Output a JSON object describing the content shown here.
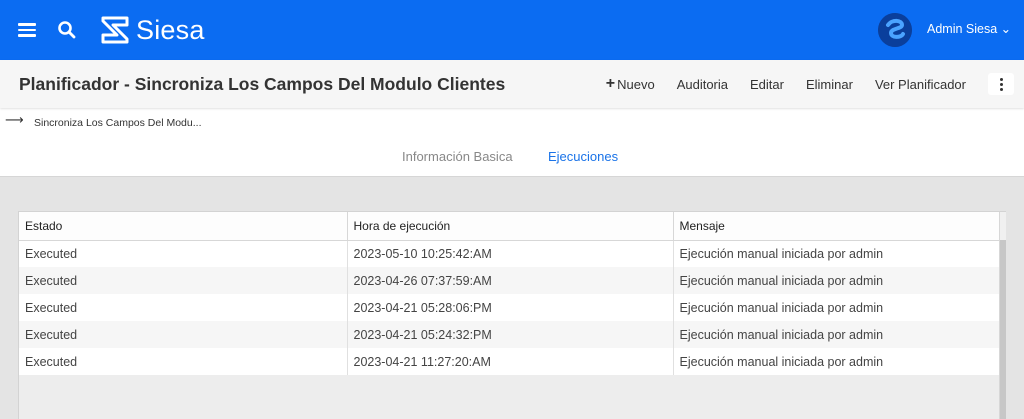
{
  "app": {
    "logo_text": "Siesa",
    "user_name": "Admin Siesa",
    "user_caret": "⌄",
    "brand_color": "#0b6cf2"
  },
  "header": {
    "title": "Planificador - Sincroniza Los Campos Del Modulo Clientes",
    "actions": {
      "nuevo": "Nuevo",
      "auditoria": "Auditoria",
      "editar": "Editar",
      "eliminar": "Eliminar",
      "ver_planificador": "Ver Planificador"
    }
  },
  "breadcrumb": {
    "arrow": "⟶",
    "crumb": "Sincroniza Los Campos Del Modu..."
  },
  "tabs": [
    {
      "label": "Información Basica",
      "active": false
    },
    {
      "label": "Ejecuciones",
      "active": true
    }
  ],
  "table": {
    "columns": [
      "Estado",
      "Hora de ejecución",
      "Mensaje"
    ],
    "rows": [
      [
        "Executed",
        "2023-05-10 10:25:42:AM",
        "Ejecución manual iniciada por admin"
      ],
      [
        "Executed",
        "2023-04-26 07:37:59:AM",
        "Ejecución manual iniciada por admin"
      ],
      [
        "Executed",
        "2023-04-21 05:28:06:PM",
        "Ejecución manual iniciada por admin"
      ],
      [
        "Executed",
        "2023-04-21 05:24:32:PM",
        "Ejecución manual iniciada por admin"
      ],
      [
        "Executed",
        "2023-04-21 11:27:20:AM",
        "Ejecución manual iniciada por admin"
      ]
    ]
  }
}
